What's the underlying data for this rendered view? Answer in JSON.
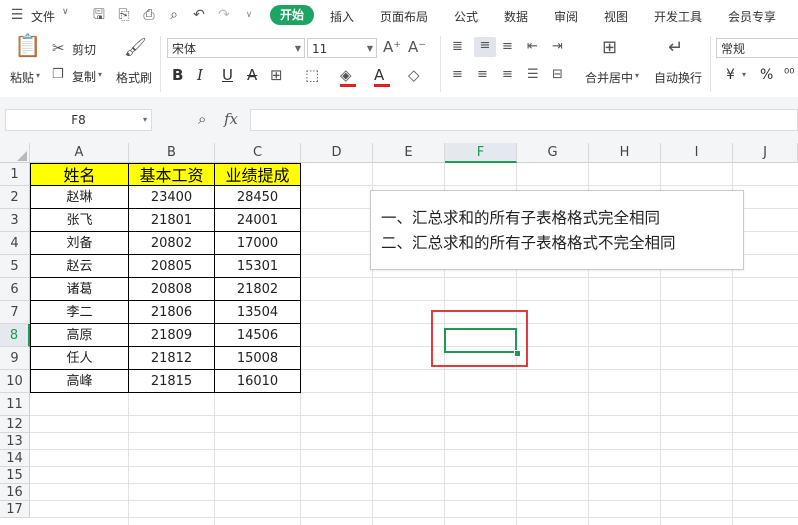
{
  "menubar": {
    "file_label": "文件",
    "tabs": [
      "开始",
      "插入",
      "页面布局",
      "公式",
      "数据",
      "审阅",
      "视图",
      "开发工具",
      "会员专享"
    ]
  },
  "ribbon": {
    "paste": "粘贴",
    "cut": "剪切",
    "copy": "复制",
    "format_painter": "格式刷",
    "font_name": "宋体",
    "font_size": "11",
    "merge_center": "合并居中",
    "wrap_text": "自动换行",
    "number_format": "常规",
    "currency_symbol": "¥",
    "percent_symbol": "%"
  },
  "formula_bar": {
    "name_box": "F8",
    "fx_label": "fx",
    "formula_value": ""
  },
  "grid": {
    "columns": [
      "A",
      "B",
      "C",
      "D",
      "E",
      "F",
      "G",
      "H",
      "I",
      "J"
    ],
    "rows": [
      "1",
      "2",
      "3",
      "4",
      "5",
      "6",
      "7",
      "8",
      "9",
      "10",
      "11",
      "12",
      "13",
      "14",
      "15",
      "16",
      "17"
    ],
    "active_cell": "F8",
    "table_header": [
      "姓名",
      "基本工资",
      "业绩提成"
    ],
    "table_rows": [
      [
        "赵琳",
        "23400",
        "28450"
      ],
      [
        "张飞",
        "21801",
        "24001"
      ],
      [
        "刘备",
        "20802",
        "17000"
      ],
      [
        "赵云",
        "20805",
        "15301"
      ],
      [
        "诸葛",
        "20808",
        "21802"
      ],
      [
        "李二",
        "21806",
        "13504"
      ],
      [
        "高原",
        "21809",
        "14506"
      ],
      [
        "任人",
        "21812",
        "15008"
      ],
      [
        "高峰",
        "21815",
        "16010"
      ]
    ]
  },
  "textbox": {
    "lines": [
      "一、汇总求和的所有子表格格式完全相同",
      "二、汇总求和的所有子表格格式不完全相同"
    ]
  },
  "colors": {
    "accent": "#1da362",
    "header_fill": "#ffff00",
    "selection_green": "#1e9a55",
    "highlight_red": "#e03c3c"
  }
}
